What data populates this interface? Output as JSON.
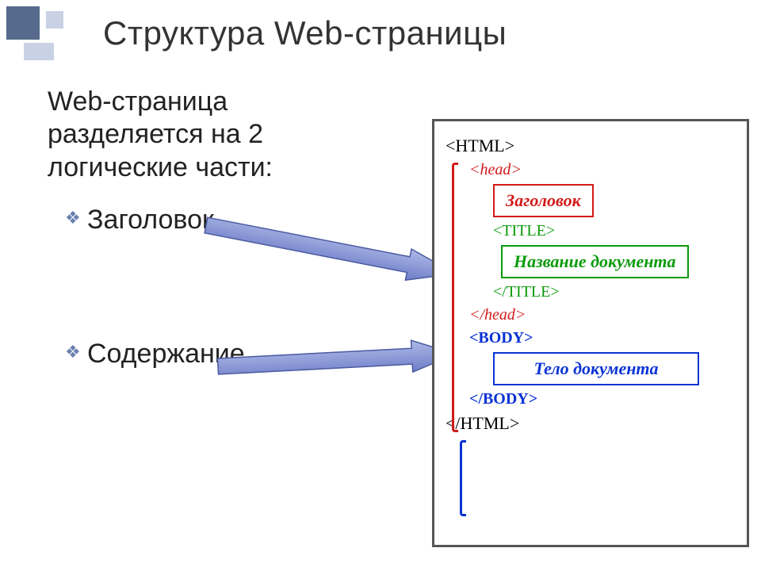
{
  "title": "Структура Web-страницы",
  "intro": "Web-страница разделяется на 2 логические части:",
  "bullets": [
    {
      "label": "Заголовок"
    },
    {
      "label": "Содержание"
    }
  ],
  "code": {
    "open_html": "<HTML>",
    "open_head": "<head>",
    "header_box": "Заголовок",
    "open_title": "<TITLE>",
    "title_box": "Название документа",
    "close_title": "</TITLE>",
    "close_head": "</head>",
    "open_body": "<BODY>",
    "body_box": "Тело документа",
    "close_body": "</BODY>",
    "close_html": "</HTML>"
  }
}
